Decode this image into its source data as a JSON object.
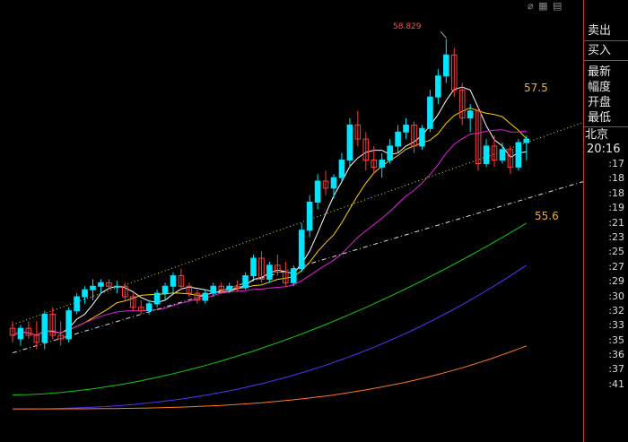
{
  "toolbar_icons": [
    "eraser-icon",
    "grid-icon",
    "grid-icon"
  ],
  "side": {
    "buttons": [
      "卖出",
      "买入"
    ],
    "fields": [
      "最新",
      "幅度",
      "开盘",
      "最低"
    ],
    "city": "北京",
    "time": "20:16",
    "ticks": [
      ":17",
      ":18",
      ":18",
      ":19",
      ":21",
      ":23",
      ":25",
      ":27",
      ":29",
      ":30",
      ":32",
      ":33",
      ":35",
      ":36",
      ":37",
      ":41"
    ]
  },
  "labels": {
    "high": "58.829",
    "upper": "57.5",
    "lower": "55.6"
  },
  "colors": {
    "up": "#00e5ff",
    "down": "#ff3b3b",
    "ma5": "#ffffff",
    "ma10": "#ffd200",
    "ma20": "#e020e0",
    "ma60": "#11cc11",
    "ma120": "#5533ff",
    "ma250": "#ff7722"
  },
  "chart_data": {
    "type": "candlestick",
    "title": "",
    "xlabel": "",
    "ylabel": "",
    "ylim": [
      53.5,
      59
    ],
    "candles": [
      {
        "o": 54.7,
        "h": 54.8,
        "l": 54.5,
        "c": 54.6
      },
      {
        "o": 54.55,
        "h": 54.75,
        "l": 54.45,
        "c": 54.7
      },
      {
        "o": 54.7,
        "h": 54.8,
        "l": 54.55,
        "c": 54.6
      },
      {
        "o": 54.6,
        "h": 54.8,
        "l": 54.4,
        "c": 54.5
      },
      {
        "o": 54.5,
        "h": 54.95,
        "l": 54.4,
        "c": 54.9
      },
      {
        "o": 54.9,
        "h": 55.0,
        "l": 54.55,
        "c": 54.6
      },
      {
        "o": 54.6,
        "h": 54.8,
        "l": 54.45,
        "c": 54.55
      },
      {
        "o": 54.55,
        "h": 55.0,
        "l": 54.5,
        "c": 54.95
      },
      {
        "o": 54.95,
        "h": 55.2,
        "l": 54.9,
        "c": 55.15
      },
      {
        "o": 55.15,
        "h": 55.3,
        "l": 55.05,
        "c": 55.25
      },
      {
        "o": 55.25,
        "h": 55.4,
        "l": 55.1,
        "c": 55.3
      },
      {
        "o": 55.3,
        "h": 55.4,
        "l": 55.2,
        "c": 55.35
      },
      {
        "o": 55.35,
        "h": 55.4,
        "l": 55.25,
        "c": 55.3
      },
      {
        "o": 55.3,
        "h": 55.38,
        "l": 55.2,
        "c": 55.3
      },
      {
        "o": 55.3,
        "h": 55.35,
        "l": 55.1,
        "c": 55.15
      },
      {
        "o": 55.15,
        "h": 55.2,
        "l": 54.95,
        "c": 55.0
      },
      {
        "o": 55.0,
        "h": 55.1,
        "l": 54.9,
        "c": 54.95
      },
      {
        "o": 54.95,
        "h": 55.1,
        "l": 54.9,
        "c": 55.05
      },
      {
        "o": 55.05,
        "h": 55.25,
        "l": 55.0,
        "c": 55.2
      },
      {
        "o": 55.2,
        "h": 55.35,
        "l": 55.1,
        "c": 55.3
      },
      {
        "o": 55.3,
        "h": 55.5,
        "l": 55.2,
        "c": 55.45
      },
      {
        "o": 55.45,
        "h": 55.55,
        "l": 55.25,
        "c": 55.3
      },
      {
        "o": 55.3,
        "h": 55.35,
        "l": 55.15,
        "c": 55.2
      },
      {
        "o": 55.2,
        "h": 55.25,
        "l": 55.05,
        "c": 55.1
      },
      {
        "o": 55.1,
        "h": 55.25,
        "l": 55.05,
        "c": 55.2
      },
      {
        "o": 55.2,
        "h": 55.35,
        "l": 55.15,
        "c": 55.3
      },
      {
        "o": 55.3,
        "h": 55.35,
        "l": 55.2,
        "c": 55.25
      },
      {
        "o": 55.25,
        "h": 55.35,
        "l": 55.2,
        "c": 55.3
      },
      {
        "o": 55.3,
        "h": 55.38,
        "l": 55.22,
        "c": 55.28
      },
      {
        "o": 55.28,
        "h": 55.5,
        "l": 55.25,
        "c": 55.45
      },
      {
        "o": 55.45,
        "h": 55.75,
        "l": 55.4,
        "c": 55.7
      },
      {
        "o": 55.7,
        "h": 55.8,
        "l": 55.35,
        "c": 55.4
      },
      {
        "o": 55.4,
        "h": 55.65,
        "l": 55.35,
        "c": 55.6
      },
      {
        "o": 55.6,
        "h": 55.75,
        "l": 55.45,
        "c": 55.5
      },
      {
        "o": 55.5,
        "h": 55.65,
        "l": 55.3,
        "c": 55.35
      },
      {
        "o": 55.35,
        "h": 55.6,
        "l": 55.3,
        "c": 55.55
      },
      {
        "o": 55.55,
        "h": 56.2,
        "l": 55.5,
        "c": 56.1
      },
      {
        "o": 56.1,
        "h": 56.6,
        "l": 56.0,
        "c": 56.5
      },
      {
        "o": 56.5,
        "h": 56.9,
        "l": 56.4,
        "c": 56.8
      },
      {
        "o": 56.8,
        "h": 56.95,
        "l": 56.6,
        "c": 56.7
      },
      {
        "o": 56.7,
        "h": 56.9,
        "l": 56.55,
        "c": 56.85
      },
      {
        "o": 56.85,
        "h": 57.2,
        "l": 56.8,
        "c": 57.1
      },
      {
        "o": 57.1,
        "h": 57.7,
        "l": 57.0,
        "c": 57.6
      },
      {
        "o": 57.6,
        "h": 57.8,
        "l": 57.3,
        "c": 57.4
      },
      {
        "o": 57.4,
        "h": 57.5,
        "l": 56.95,
        "c": 57.1
      },
      {
        "o": 57.1,
        "h": 57.3,
        "l": 56.9,
        "c": 57.0
      },
      {
        "o": 57.0,
        "h": 57.2,
        "l": 56.85,
        "c": 57.1
      },
      {
        "o": 57.1,
        "h": 57.4,
        "l": 57.05,
        "c": 57.3
      },
      {
        "o": 57.3,
        "h": 57.6,
        "l": 57.2,
        "c": 57.5
      },
      {
        "o": 57.5,
        "h": 57.7,
        "l": 57.4,
        "c": 57.6
      },
      {
        "o": 57.6,
        "h": 57.65,
        "l": 57.2,
        "c": 57.3
      },
      {
        "o": 57.3,
        "h": 57.6,
        "l": 57.25,
        "c": 57.55
      },
      {
        "o": 57.55,
        "h": 58.1,
        "l": 57.5,
        "c": 58.0
      },
      {
        "o": 58.0,
        "h": 58.4,
        "l": 57.9,
        "c": 58.3
      },
      {
        "o": 58.3,
        "h": 58.83,
        "l": 58.2,
        "c": 58.6
      },
      {
        "o": 58.6,
        "h": 58.7,
        "l": 58.0,
        "c": 58.1
      },
      {
        "o": 58.1,
        "h": 58.2,
        "l": 57.6,
        "c": 57.7
      },
      {
        "o": 57.7,
        "h": 57.9,
        "l": 57.5,
        "c": 57.8
      },
      {
        "o": 57.8,
        "h": 57.85,
        "l": 56.95,
        "c": 57.05
      },
      {
        "o": 57.05,
        "h": 57.4,
        "l": 57.0,
        "c": 57.3
      },
      {
        "o": 57.3,
        "h": 57.45,
        "l": 57.0,
        "c": 57.1
      },
      {
        "o": 57.1,
        "h": 57.35,
        "l": 57.05,
        "c": 57.25
      },
      {
        "o": 57.25,
        "h": 57.3,
        "l": 56.9,
        "c": 57.0
      },
      {
        "o": 57.0,
        "h": 57.4,
        "l": 56.95,
        "c": 57.35
      },
      {
        "o": 57.35,
        "h": 57.45,
        "l": 57.1,
        "c": 57.4
      }
    ],
    "trendlines": [
      {
        "name": "",
        "style": "dotted",
        "color": "#e8e030",
        "from": [
          0,
          54.75
        ],
        "to": [
          64,
          57.35
        ]
      },
      {
        "name": "",
        "style": "dashdot",
        "color": "#dddddd",
        "from": [
          0,
          54.35
        ],
        "to": [
          64,
          56.55
        ]
      }
    ],
    "right_labels": [
      "57.5",
      "55.6"
    ],
    "high_label": "58.829",
    "time_ticks": [
      ":17",
      ":18",
      ":18",
      ":19",
      ":21",
      ":23",
      ":25",
      ":27",
      ":29",
      ":30",
      ":32",
      ":33",
      ":35",
      ":36",
      ":37",
      ":41"
    ]
  }
}
